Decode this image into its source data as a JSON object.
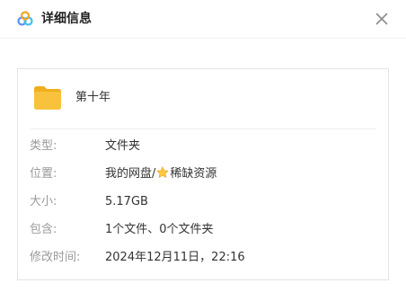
{
  "dialog": {
    "title": "详细信息",
    "close_icon": "close-icon",
    "logo_icon": "cloud-logo-icon"
  },
  "item": {
    "name": "第十年",
    "icon": "folder-icon",
    "folder_color": "#F9C23C"
  },
  "details": {
    "type_label": "类型:",
    "type_value": "文件夹",
    "location_label": "位置:",
    "location_prefix": "我的网盘/",
    "location_star_icon": "star-icon",
    "location_suffix": "稀缺资源",
    "size_label": "大小:",
    "size_value": "5.17GB",
    "contains_label": "包含:",
    "contains_value": "1个文件、0个文件夹",
    "modified_label": "修改时间:",
    "modified_value": "2024年12月11日，22:16"
  }
}
